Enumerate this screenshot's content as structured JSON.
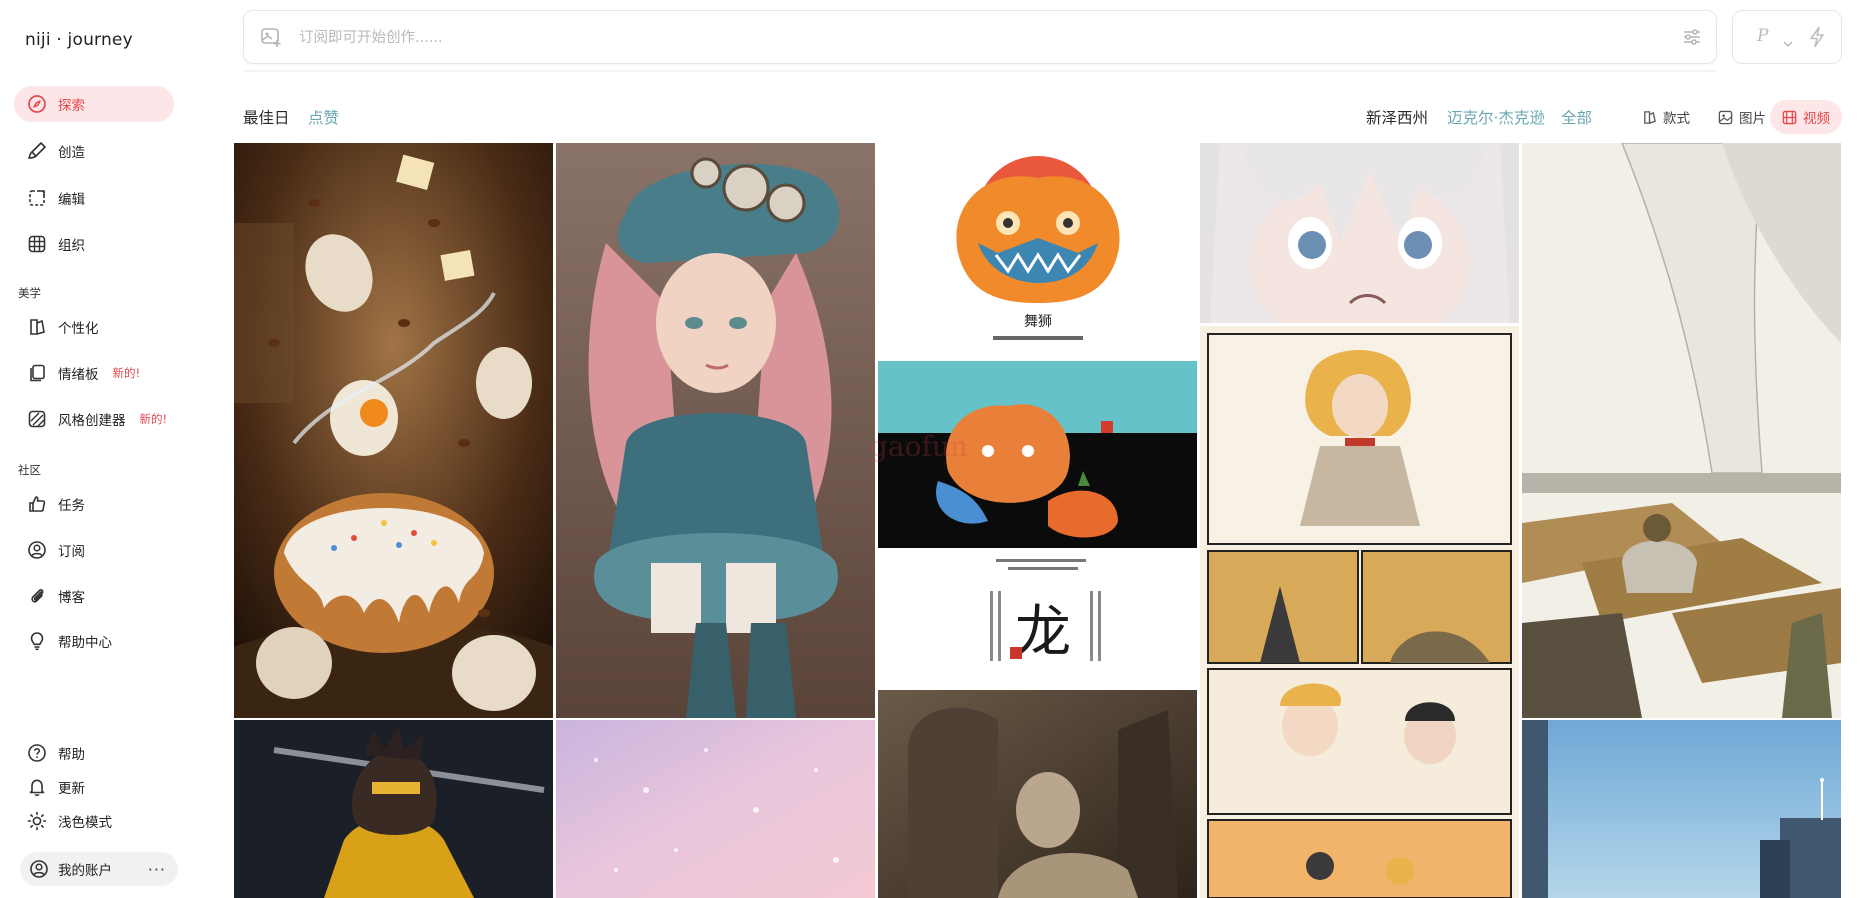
{
  "brand": {
    "logo": "niji · journey"
  },
  "sidebar": {
    "primary": [
      {
        "label": "探索",
        "icon": "compass-icon",
        "active": true
      },
      {
        "label": "创造",
        "icon": "brush-icon"
      },
      {
        "label": "编辑",
        "icon": "edit-frame-icon"
      },
      {
        "label": "组织",
        "icon": "grid-icon"
      }
    ],
    "section_aesthetics": "美学",
    "aesthetics": [
      {
        "label": "个性化",
        "icon": "personalize-icon"
      },
      {
        "label": "情绪板",
        "icon": "moodboard-icon",
        "badge": "新的!"
      },
      {
        "label": "风格创建器",
        "icon": "style-creator-icon",
        "badge": "新的!"
      }
    ],
    "section_community": "社区",
    "community": [
      {
        "label": "任务",
        "icon": "thumbs-up-icon"
      },
      {
        "label": "订阅",
        "icon": "user-circle-icon"
      },
      {
        "label": "博客",
        "icon": "paperclip-icon"
      },
      {
        "label": "帮助中心",
        "icon": "lightbulb-icon"
      }
    ],
    "bottom": [
      {
        "label": "帮助",
        "icon": "question-icon"
      },
      {
        "label": "更新",
        "icon": "bell-icon"
      },
      {
        "label": "浅色模式",
        "icon": "sun-icon"
      }
    ],
    "account": {
      "label": "我的账户",
      "more": "···"
    }
  },
  "search": {
    "placeholder": "订阅即可开始创作......",
    "model_label": "P"
  },
  "tabs_left": [
    {
      "label": "最佳日",
      "active": true
    },
    {
      "label": "点赞",
      "active": false
    }
  ],
  "tabs_right": [
    {
      "label": "新泽西州",
      "active": true
    },
    {
      "label": "迈克尔·杰克逊",
      "active": false
    },
    {
      "label": "全部",
      "active": false
    }
  ],
  "media_filters": [
    {
      "label": "款式",
      "icon": "style-icon",
      "active": false
    },
    {
      "label": "图片",
      "icon": "image-icon",
      "active": false
    },
    {
      "label": "视频",
      "icon": "video-icon",
      "active": true
    }
  ],
  "colors": {
    "accent": "#e5484d",
    "accent_bg": "#fde6e7",
    "muted_tab": "#6aa8b2"
  },
  "gallery": {
    "watermark": "gaofun",
    "poster_titles": [
      "舞狮",
      "龙"
    ]
  }
}
